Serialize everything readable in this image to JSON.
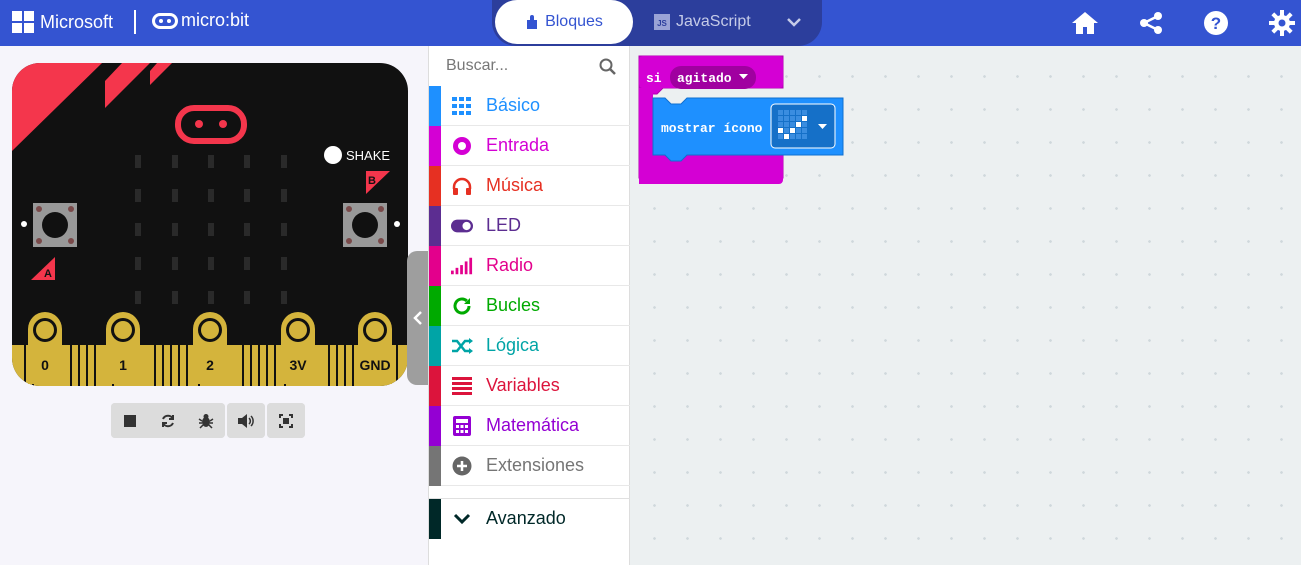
{
  "header": {
    "microsoft_label": "Microsoft",
    "microbit_label": "micro:bit",
    "tab_blocks": "Bloques",
    "tab_js": "JavaScript",
    "js_badge": "JS"
  },
  "simulator": {
    "shake_label": "SHAKE",
    "button_a": "A",
    "button_b": "B",
    "pins": [
      "0",
      "1",
      "2",
      "3V",
      "GND"
    ]
  },
  "toolbox": {
    "search_placeholder": "Buscar...",
    "categories": [
      {
        "label": "Básico",
        "color": "#1e90ff",
        "icon": "grid-icon"
      },
      {
        "label": "Entrada",
        "color": "#d400d4",
        "icon": "circle-dot-icon"
      },
      {
        "label": "Música",
        "color": "#e63022",
        "icon": "headphones-icon"
      },
      {
        "label": "LED",
        "color": "#5c2d91",
        "icon": "toggle-icon"
      },
      {
        "label": "Radio",
        "color": "#e3008c",
        "icon": "signal-bars-icon"
      },
      {
        "label": "Bucles",
        "color": "#00aa00",
        "icon": "refresh-icon"
      },
      {
        "label": "Lógica",
        "color": "#00a4a6",
        "icon": "shuffle-icon"
      },
      {
        "label": "Variables",
        "color": "#dc143c",
        "icon": "list-lines-icon"
      },
      {
        "label": "Matemática",
        "color": "#9400d3",
        "icon": "calculator-icon"
      },
      {
        "label": "Extensiones",
        "color": "#757575",
        "icon": "plus-circle-icon"
      }
    ],
    "advanced": {
      "label": "Avanzado",
      "color": "#002828",
      "icon": "chevron-down-icon"
    }
  },
  "workspace": {
    "event_block": {
      "keyword": "si",
      "dropdown_value": "agitado",
      "color": "#d400d4"
    },
    "inner_block": {
      "label": "mostrar ícono",
      "color": "#1e90ff"
    }
  }
}
